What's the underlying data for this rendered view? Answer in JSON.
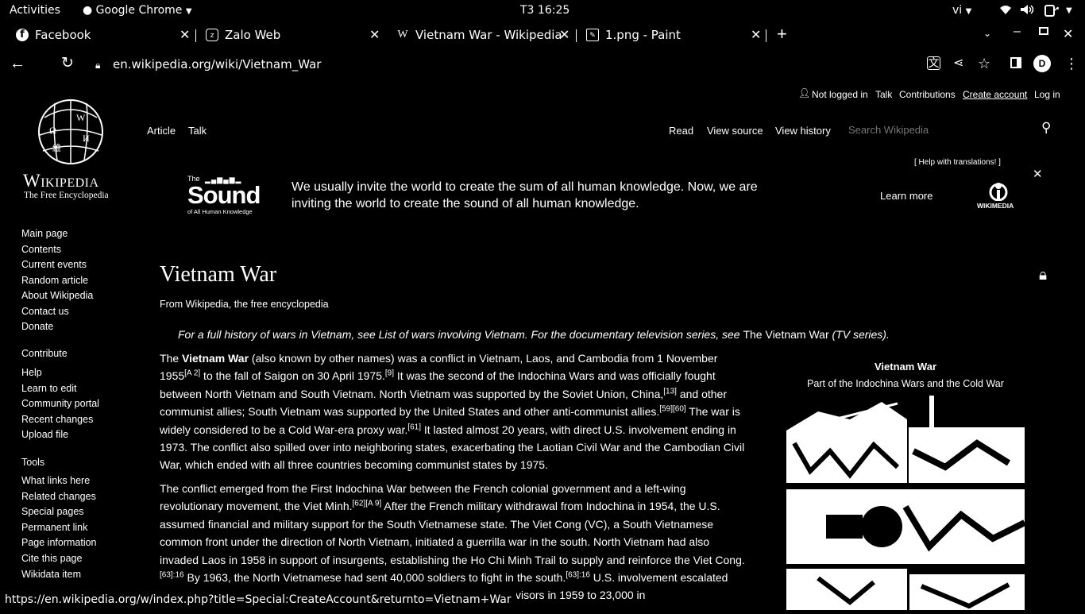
{
  "system": {
    "activities": "Activities",
    "app": "Google Chrome",
    "clock": "T3 16:25",
    "lang": "vi"
  },
  "tabs": [
    {
      "label": "Facebook",
      "icon": "facebook-icon"
    },
    {
      "label": "Zalo Web",
      "icon": "zalo-icon"
    },
    {
      "label": "Vietnam War - Wikipedia",
      "icon": "wikipedia-icon"
    },
    {
      "label": "1.png - Paint",
      "icon": "paint-icon"
    }
  ],
  "address": {
    "url": "en.wikipedia.org/wiki/Vietnam_War",
    "profile_initial": "D"
  },
  "wiki": {
    "wordmark": "Wikipedia",
    "tagline": "The Free Encyclopedia",
    "personal": {
      "not_logged": "Not logged in",
      "talk": "Talk",
      "contributions": "Contributions",
      "create_account": "Create account",
      "login": "Log in"
    },
    "tabs": {
      "article": "Article",
      "talk": "Talk",
      "read": "Read",
      "view_source": "View source",
      "view_history": "View history"
    },
    "search_placeholder": "Search Wikipedia",
    "banner": {
      "help": "[ Help with translations! ]",
      "logo_small": "The",
      "logo_big": "Sound",
      "logo_sub": "of All Human Knowledge",
      "text": "We usually invite the world to create the sum of all human knowledge. Now, we are inviting the world to create the sound of all human knowledge.",
      "learn_more": "Learn more",
      "wikimedia": "WIKIMEDIA"
    },
    "nav": {
      "main": [
        "Main page",
        "Contents",
        "Current events",
        "Random article",
        "About Wikipedia",
        "Contact us",
        "Donate"
      ],
      "contribute_heading": "Contribute",
      "contribute": [
        "Help",
        "Learn to edit",
        "Community portal",
        "Recent changes",
        "Upload file"
      ],
      "tools_heading": "Tools",
      "tools": [
        "What links here",
        "Related changes",
        "Special pages",
        "Permanent link",
        "Page information",
        "Cite this page",
        "Wikidata item"
      ]
    },
    "title": "Vietnam War",
    "from": "From Wikipedia, the free encyclopedia",
    "hatnote_pre": "For a full history of wars in Vietnam, see List of wars involving Vietnam. For the documentary television series, see ",
    "hatnote_link": "The Vietnam War",
    "hatnote_post": " (TV series).",
    "infobox": {
      "title": "Vietnam War",
      "subtitle": "Part of the Indochina Wars and the Cold War"
    },
    "status_url": "https://en.wikipedia.org/w/index.php?title=Special:CreateAccount&returnto=Vietnam+War"
  }
}
